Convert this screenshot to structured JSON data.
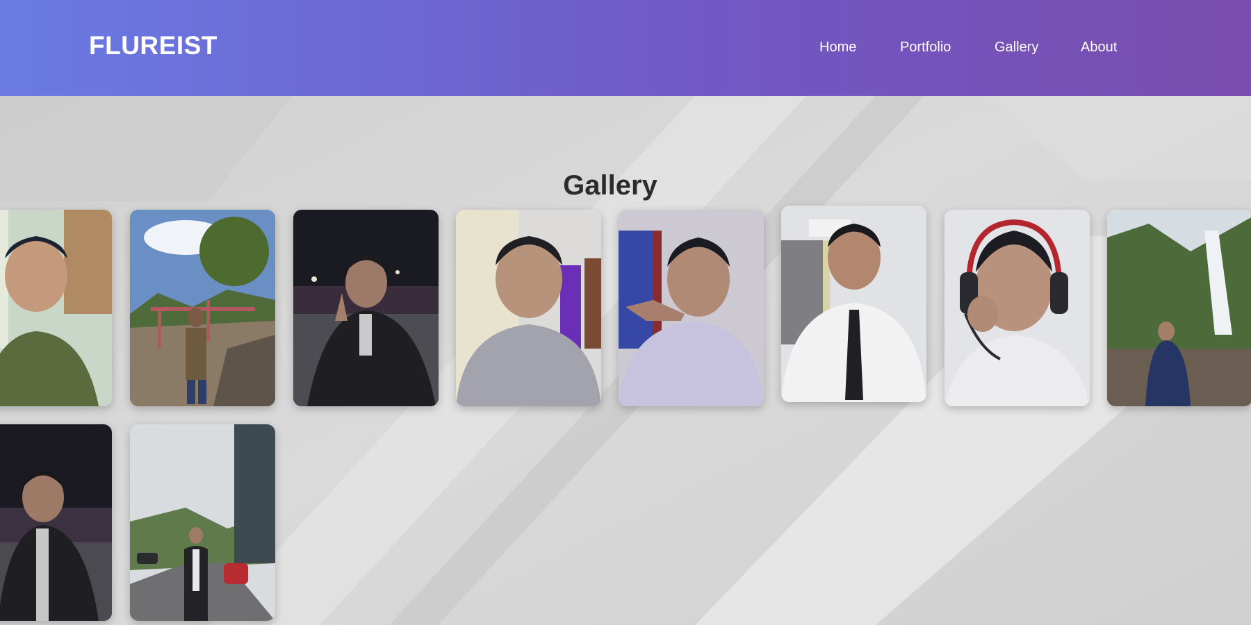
{
  "site": {
    "brand": "FLUREIST"
  },
  "nav": {
    "items": [
      "Home",
      "Portfolio",
      "Gallery",
      "About"
    ]
  },
  "gallery": {
    "title": "Gallery",
    "photos": [
      {
        "scene": "portrait in hallway, green t-shirt"
      },
      {
        "scene": "outdoor hilltop with red railing and tree"
      },
      {
        "scene": "night selfie with peace sign, black jacket"
      },
      {
        "scene": "selfie in room, grey shirt, purple curtain"
      },
      {
        "scene": "selfie with peace sign, lavender shirt"
      },
      {
        "scene": "portrait in white shirt and black tie"
      },
      {
        "scene": "portrait with gaming headset"
      },
      {
        "scene": "waterfall in forest, navy sweater"
      },
      {
        "scene": "night street portrait, black jacket"
      },
      {
        "scene": "roadside mountain view, black jacket"
      }
    ]
  }
}
